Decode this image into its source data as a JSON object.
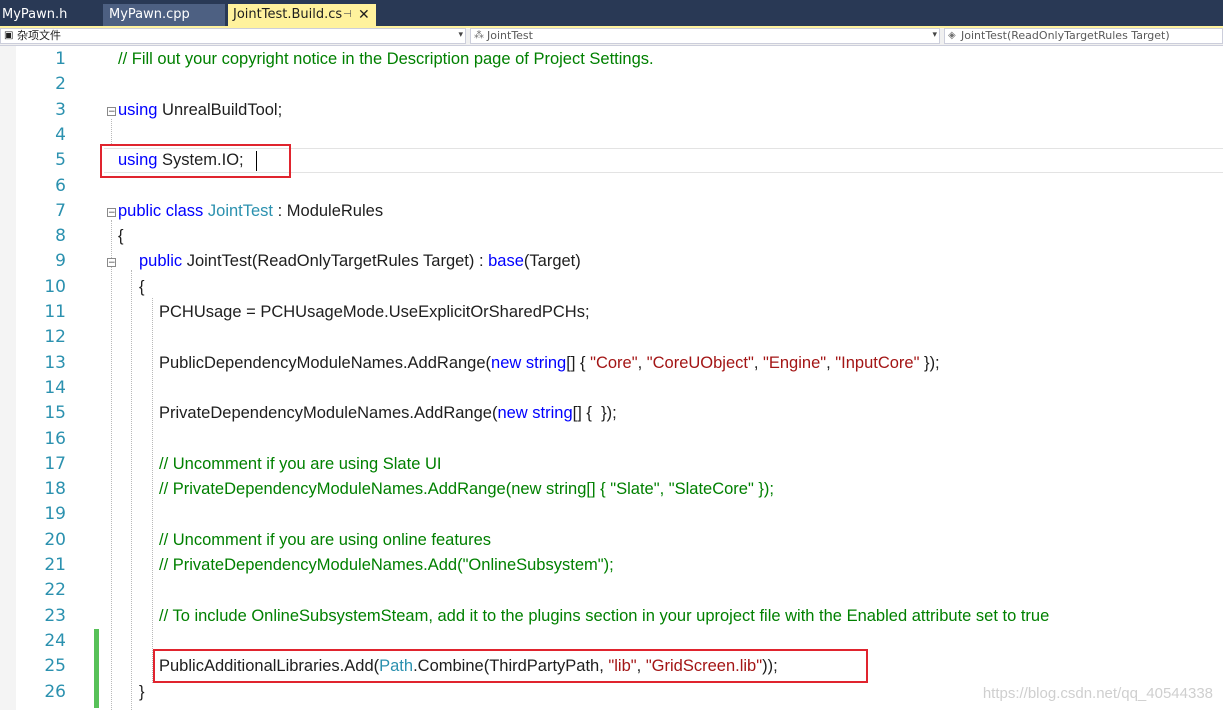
{
  "tabs": [
    {
      "label": "MyPawn.h"
    },
    {
      "label": "MyPawn.cpp"
    },
    {
      "label": "JointTest.Build.cs",
      "pin_glyph": "⊣",
      "close_glyph": "✕"
    }
  ],
  "navbar": {
    "project": "杂项文件",
    "class_scope": "JointTest",
    "member_scope": "JointTest(ReadOnlyTargetRules Target)"
  },
  "line_numbers": [
    "1",
    "2",
    "3",
    "4",
    "5",
    "6",
    "7",
    "8",
    "9",
    "10",
    "11",
    "12",
    "13",
    "14",
    "15",
    "16",
    "17",
    "18",
    "19",
    "20",
    "21",
    "22",
    "23",
    "24",
    "25",
    "26"
  ],
  "code": {
    "l1": "// Fill out your copyright notice in the Description page of Project Settings.",
    "l3_kw": "using",
    "l3_rest": " UnrealBuildTool;",
    "l5_kw": "using",
    "l5_rest": " System.IO;",
    "l7_kw": "public class",
    "l7_type": "JointTest",
    "l7_rest": " : ModuleRules",
    "l8": "{",
    "l9_kw": "public",
    "l9_mid": " JointTest(ReadOnlyTargetRules Target) : ",
    "l9_base": "base",
    "l9_end": "(Target)",
    "l10": "{",
    "l11": "PCHUsage = PCHUsageMode.UseExplicitOrSharedPCHs;",
    "l13_a": "PublicDependencyModuleNames.AddRange(",
    "l13_kw": "new string",
    "l13_b": "[] { ",
    "l13_s1": "\"Core\"",
    "l13_s2": "\"CoreUObject\"",
    "l13_s3": "\"Engine\"",
    "l13_s4": "\"InputCore\"",
    "l13_sep": ", ",
    "l13_end": " });",
    "l15_a": "PrivateDependencyModuleNames.AddRange(",
    "l15_kw": "new string",
    "l15_b": "[] {  });",
    "l17": "// Uncomment if you are using Slate UI",
    "l18": "// PrivateDependencyModuleNames.AddRange(new string[] { \"Slate\", \"SlateCore\" });",
    "l20": "// Uncomment if you are using online features",
    "l21": "// PrivateDependencyModuleNames.Add(\"OnlineSubsystem\");",
    "l23": "// To include OnlineSubsystemSteam, add it to the plugins section in your uproject file with the Enabled attribute set to true",
    "l25_a": "PublicAdditionalLibraries.Add(",
    "l25_type": "Path",
    "l25_b": ".Combine(ThirdPartyPath, ",
    "l25_s1": "\"lib\"",
    "l25_sep": ", ",
    "l25_s2": "\"GridScreen.lib\"",
    "l25_end": "));",
    "l26": "}"
  },
  "watermark": "https://blog.csdn.net/qq_40544338",
  "colors": {
    "keyword": "#0000ff",
    "type": "#2b91af",
    "string": "#a31515",
    "comment": "#008000",
    "highlight_box": "#e0242e",
    "changed_line_bar": "#57c158"
  }
}
